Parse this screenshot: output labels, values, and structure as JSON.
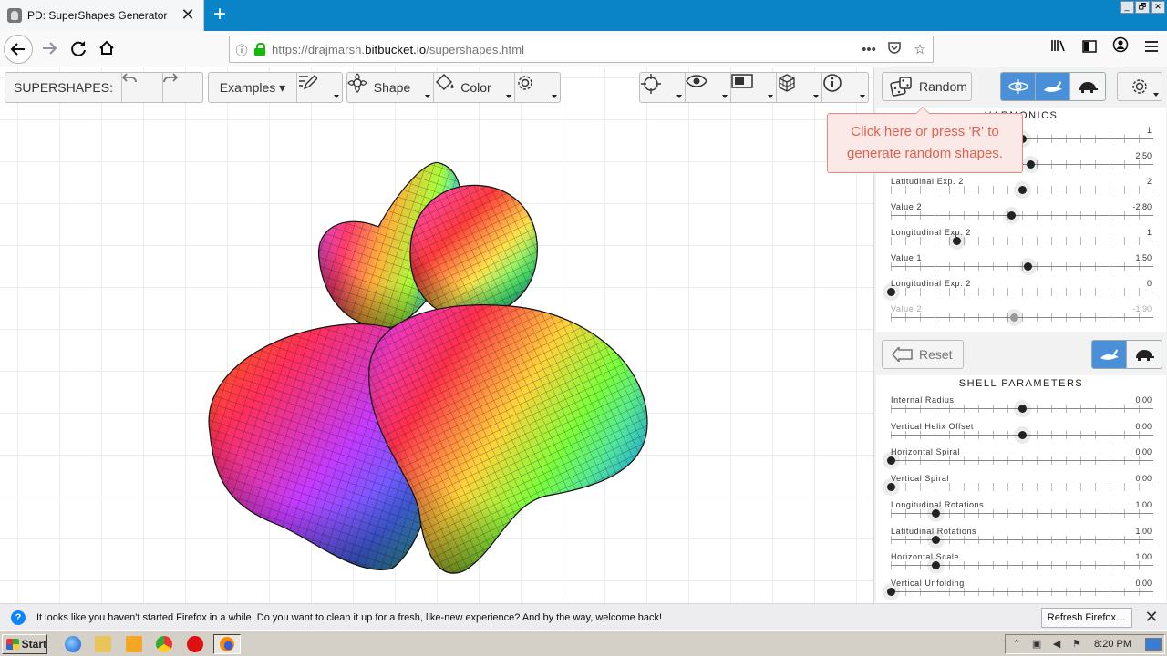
{
  "browser": {
    "tab_title": "PD: SuperShapes Generator",
    "tab_close": "✕",
    "new_tab": "+",
    "window_buttons": [
      "_",
      "🗗",
      "✕"
    ],
    "url_prefix": "https://drajmarsh.",
    "url_domain": "bitbucket.io",
    "url_path": "/supershapes.html",
    "url_more": "•••"
  },
  "toolbar": {
    "app_label": "SUPERSHAPES:",
    "examples_label": "Examples ▾",
    "shape_label": "Shape",
    "color_label": "Color",
    "random_label": "Random",
    "reset_label": "Reset"
  },
  "tooltip": {
    "text": "Click here or press 'R' to generate random shapes."
  },
  "harmonics_panel": {
    "title": "HARMONICS",
    "sliders": [
      {
        "label": "",
        "value": "1",
        "fraction": 0.5
      },
      {
        "label": "",
        "value": "2.50",
        "fraction": 0.53
      },
      {
        "label": "Latitudinal Exp. 2",
        "value": "2",
        "fraction": 0.5
      },
      {
        "label": "Value 2",
        "value": "-2.80",
        "fraction": 0.46
      },
      {
        "label": "Longitudinal Exp. 2",
        "value": "1",
        "fraction": 0.25
      },
      {
        "label": "Value 1",
        "value": "1.50",
        "fraction": 0.52
      },
      {
        "label": "Longitudinal Exp. 2",
        "value": "0",
        "fraction": 0.0
      },
      {
        "label": "Value 2",
        "value": "-1.90",
        "fraction": 0.47,
        "dim": true
      }
    ]
  },
  "shell_panel": {
    "title": "SHELL PARAMETERS",
    "sliders": [
      {
        "label": "Internal Radius",
        "value": "0.00",
        "fraction": 0.5
      },
      {
        "label": "Vertical Helix Offset",
        "value": "0.00",
        "fraction": 0.5
      },
      {
        "label": "Horizontal Spiral",
        "value": "0.00",
        "fraction": 0.0
      },
      {
        "label": "Vertical Spiral",
        "value": "0.00",
        "fraction": 0.0
      },
      {
        "label": "Longitudinal Rotations",
        "value": "1.00",
        "fraction": 0.17
      },
      {
        "label": "Latitudinal Rotations",
        "value": "1.00",
        "fraction": 0.17
      },
      {
        "label": "Horizontal Scale",
        "value": "1.00",
        "fraction": 0.17
      },
      {
        "label": "Vertical Unfolding",
        "value": "0.00",
        "fraction": 0.0
      }
    ]
  },
  "notification": {
    "text": "It looks like you haven't started Firefox in a while. Do you want to clean it up for a fresh, like-new experience? And by the way, welcome back!",
    "button": "Refresh Firefox…",
    "close": "✕"
  },
  "taskbar": {
    "start_label": "Start",
    "clock": "8:20 PM"
  },
  "colors": {
    "accent": "#4a90d9",
    "tooltip_text": "#e4604e",
    "tab_bar": "#0a84c6"
  }
}
